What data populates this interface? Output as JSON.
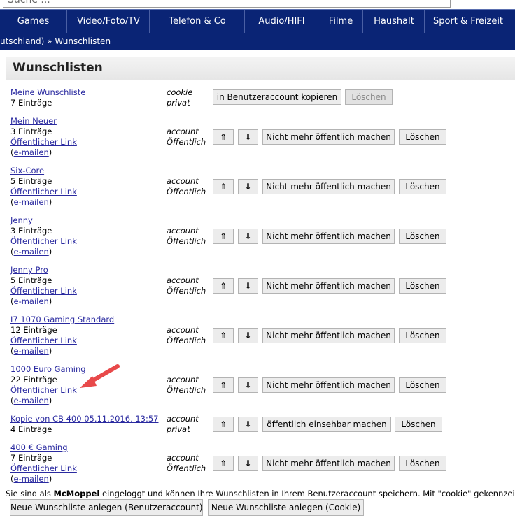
{
  "search": {
    "placeholder": "Suche ..."
  },
  "nav": [
    {
      "label": "Games"
    },
    {
      "label": "Video/Foto/TV"
    },
    {
      "label": "Telefon & Co"
    },
    {
      "label": "Audio/HIFI"
    },
    {
      "label": "Filme"
    },
    {
      "label": "Haushalt"
    },
    {
      "label": "Sport & Freizeit"
    }
  ],
  "breadcrumb": "utschland) » Wunschlisten",
  "panel_title": "Wunschlisten",
  "labels": {
    "public_link": "Öffentlicher Link",
    "email_open": "(",
    "email_link": "e-mailen",
    "email_close": ")",
    "up": "⇑",
    "down": "⇓",
    "delete": "Löschen",
    "make_private": "Nicht mehr öffentlich machen",
    "make_public": "öffentlich einsehbar machen",
    "copy_to_account": "in Benutzeraccount kopieren"
  },
  "lists": [
    {
      "name": "Meine Wunschliste",
      "count": "7 Einträge",
      "storage": "cookie",
      "visibility": "privat"
    },
    {
      "name": "Mein Neuer",
      "count": "3 Einträge",
      "storage": "account",
      "visibility": "Öffentlich"
    },
    {
      "name": "Six-Core",
      "count": "5 Einträge",
      "storage": "account",
      "visibility": "Öffentlich"
    },
    {
      "name": "Jenny",
      "count": "3 Einträge",
      "storage": "account",
      "visibility": "Öffentlich"
    },
    {
      "name": "Jenny Pro",
      "count": "5 Einträge",
      "storage": "account",
      "visibility": "Öffentlich"
    },
    {
      "name": "I7 1070 Gaming Standard",
      "count": "12 Einträge",
      "storage": "account",
      "visibility": "Öffentlich"
    },
    {
      "name": "1000 Euro Gaming",
      "count": "22 Einträge",
      "storage": "account",
      "visibility": "Öffentlich"
    },
    {
      "name": "Kopie von CB 400 05.11.2016, 13:57",
      "count": "4 Einträge",
      "storage": "account",
      "visibility": "privat"
    },
    {
      "name": "400 € Gaming",
      "count": "7 Einträge",
      "storage": "account",
      "visibility": "Öffentlich"
    }
  ],
  "footer": {
    "pre": "Sie sind als ",
    "user": "McMoppel",
    "post": " eingeloggt und können Ihre Wunschlisten in Ihrem Benutzeraccount speichern. Mit \"cookie\" gekennzeic"
  },
  "buttons": {
    "new_account": "Neue Wunschliste anlegen (Benutzeraccount)",
    "new_cookie": "Neue Wunschliste anlegen (Cookie)"
  },
  "colors": {
    "nav_bg": "#0a2475",
    "link": "#2a2aa0",
    "arrow": "#e8494a"
  }
}
